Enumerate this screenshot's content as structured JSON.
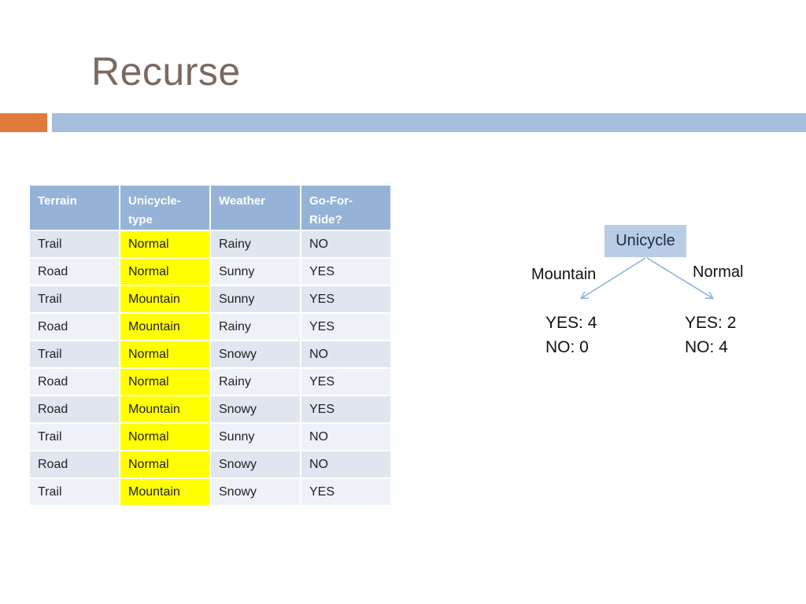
{
  "title": "Recurse",
  "table": {
    "headers": [
      [
        "Terrain"
      ],
      [
        "Unicycle-",
        "type"
      ],
      [
        "Weather"
      ],
      [
        "Go-For-",
        "Ride?"
      ]
    ],
    "rows": [
      [
        "Trail",
        "Normal",
        "Rainy",
        "NO"
      ],
      [
        "Road",
        "Normal",
        "Sunny",
        "YES"
      ],
      [
        "Trail",
        "Mountain",
        "Sunny",
        "YES"
      ],
      [
        "Road",
        "Mountain",
        "Rainy",
        "YES"
      ],
      [
        "Trail",
        "Normal",
        "Snowy",
        "NO"
      ],
      [
        "Road",
        "Normal",
        "Rainy",
        "YES"
      ],
      [
        "Road",
        "Mountain",
        "Snowy",
        "YES"
      ],
      [
        "Trail",
        "Normal",
        "Sunny",
        "NO"
      ],
      [
        "Road",
        "Normal",
        "Snowy",
        "NO"
      ],
      [
        "Trail",
        "Mountain",
        "Snowy",
        "YES"
      ]
    ]
  },
  "tree": {
    "root": "Unicycle",
    "left": {
      "branch": "Mountain",
      "yes": "YES: 4",
      "no": "NO: 0"
    },
    "right": {
      "branch": "Normal",
      "yes": "YES: 2",
      "no": "NO: 4"
    }
  },
  "colors": {
    "header_bg": "#95b3d7",
    "highlight": "#ffff00",
    "accent_orange": "#e07b3c",
    "accent_blue": "#a3bfdb",
    "node_bg": "#b8cce4",
    "arrow": "#8aaed6"
  }
}
